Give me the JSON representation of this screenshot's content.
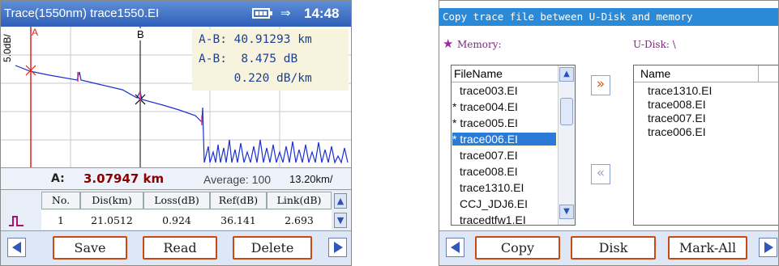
{
  "otdr": {
    "title": "Trace(1550nm) trace1550.EI",
    "time": "14:48",
    "scale_label": "5.0dB/",
    "marker_a": "A",
    "marker_b": "B",
    "panel": {
      "line1": "A-B: 40.91293 km",
      "line2": "A-B:  8.475 dB",
      "line3": "     0.220 dB/km"
    },
    "cursor": {
      "label": "A:",
      "value": "3.07947 km"
    },
    "average": "Average: 100",
    "range": "13.20km/",
    "table": {
      "headers": [
        "No.",
        "Dis(km)",
        "Loss(dB)",
        "Ref(dB)",
        "Link(dB)"
      ],
      "row": [
        "1",
        "21.0512",
        "0.924",
        "36.141",
        "2.693"
      ]
    },
    "buttons": {
      "save": "Save",
      "read": "Read",
      "delete": "Delete"
    },
    "colors": {
      "title_bg": "#3a6fc8",
      "trace": "#1a2fd0",
      "event": "#e03060",
      "marker_a": "#e02020",
      "panel_text": "#1c3f96",
      "accent_border": "#c84a12"
    },
    "icons": [
      "battery-icon",
      "plug-icon",
      "event-icon",
      "left-arrow-icon",
      "right-arrow-icon",
      "scroll-up-icon",
      "scroll-down-icon"
    ]
  },
  "filecopy": {
    "title": "Copy trace file between U-Disk and memory",
    "memory_label": "Memory:",
    "udisk_label": "U-Disk: \\",
    "memory_header": "FileName",
    "udisk_header": "Name",
    "memory_files": [
      "trace003.EI",
      "* trace004.EI",
      "* trace005.EI",
      "* trace006.EI",
      "trace007.EI",
      "trace008.EI",
      "trace1310.EI",
      "CCJ_JDJ6.EI",
      "tracedtfw1.EI"
    ],
    "selected_index": 3,
    "udisk_files": [
      "trace1310.EI",
      "trace008.EI",
      "trace007.EI",
      "trace006.EI"
    ],
    "buttons": {
      "copy": "Copy",
      "disk": "Disk",
      "mark_all": "Mark-All"
    },
    "icons": [
      "star-icon",
      "copy-right-icon",
      "copy-left-icon",
      "left-arrow-icon",
      "right-arrow-icon"
    ]
  }
}
